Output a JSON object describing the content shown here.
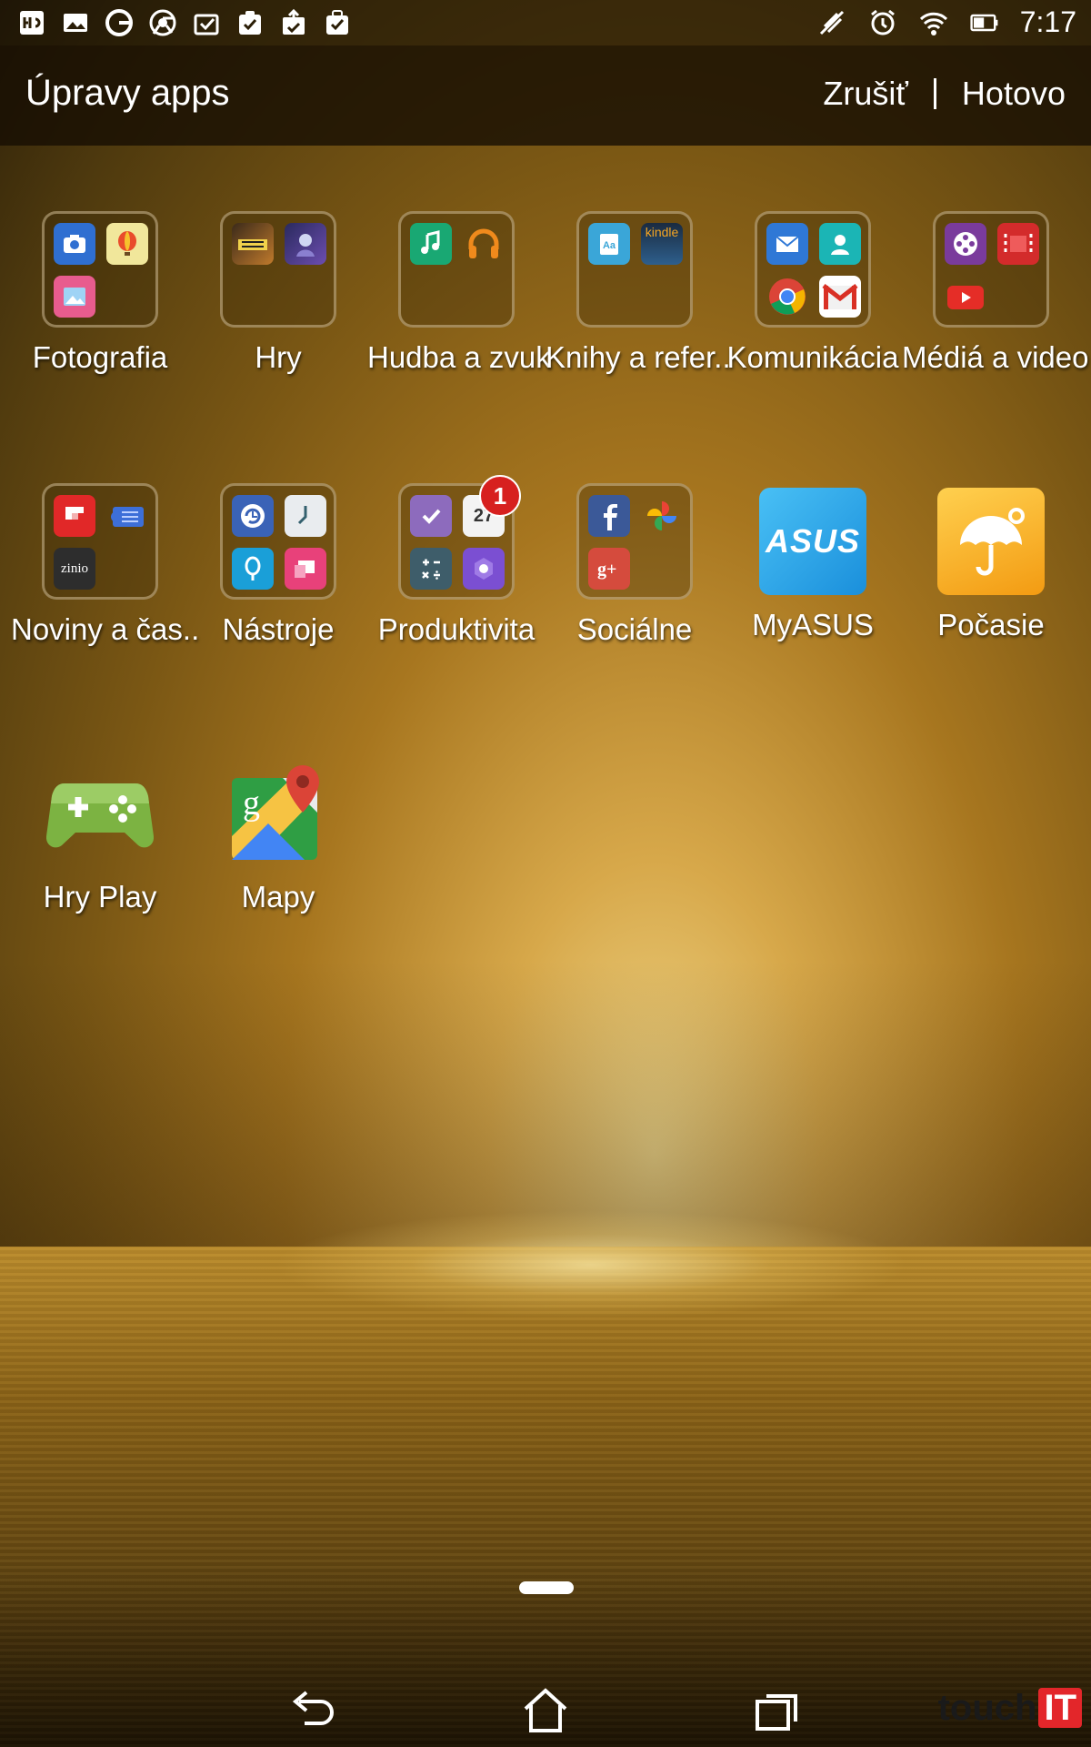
{
  "status_bar": {
    "time": "7:17",
    "left_icons": [
      "system-monitor-icon",
      "gallery-icon",
      "google-icon",
      "chrome-icon",
      "task-done-icon",
      "clipboard-check-icon",
      "upload-check-icon",
      "briefcase-check-icon"
    ],
    "right_icons": [
      "mute-icon",
      "alarm-icon",
      "wifi-icon",
      "battery-icon"
    ]
  },
  "action_bar": {
    "title": "Úpravy apps",
    "cancel_label": "Zrušiť",
    "done_label": "Hotovo"
  },
  "apps": [
    {
      "label": "Fotografia",
      "type": "folder"
    },
    {
      "label": "Hry",
      "type": "folder"
    },
    {
      "label": "Hudba a zvuk",
      "type": "folder"
    },
    {
      "label": "Knihy a refer..",
      "type": "folder",
      "mini_text": "kindle"
    },
    {
      "label": "Komunikácia",
      "type": "folder"
    },
    {
      "label": "Médiá a video",
      "type": "folder"
    },
    {
      "label": "Noviny a čas..",
      "type": "folder",
      "mini_text": "zinio"
    },
    {
      "label": "Nástroje",
      "type": "folder"
    },
    {
      "label": "Produktivita",
      "type": "folder",
      "badge": "1",
      "mini_text": "27"
    },
    {
      "label": "Sociálne",
      "type": "folder"
    },
    {
      "label": "MyASUS",
      "type": "app",
      "icon_text": "ASUS",
      "color": "#29a5e8"
    },
    {
      "label": "Počasie",
      "type": "app",
      "color": "#f5b323"
    },
    {
      "label": "Hry Play",
      "type": "app",
      "color": "#8bc34a"
    },
    {
      "label": "Mapy",
      "type": "app"
    }
  ],
  "navigation": {
    "icons": [
      "back-icon",
      "home-icon",
      "recents-icon"
    ]
  },
  "watermark": {
    "text": "touch",
    "accent": "IT"
  },
  "colors": {
    "badge": "#d7201f",
    "asus_blue": "#29a5e8",
    "weather_orange": "#f5b323"
  }
}
